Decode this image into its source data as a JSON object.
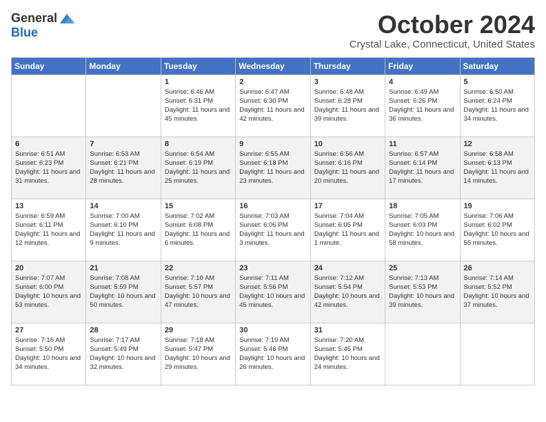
{
  "header": {
    "logo_general": "General",
    "logo_blue": "Blue",
    "month_title": "October 2024",
    "location": "Crystal Lake, Connecticut, United States"
  },
  "weekdays": [
    "Sunday",
    "Monday",
    "Tuesday",
    "Wednesday",
    "Thursday",
    "Friday",
    "Saturday"
  ],
  "weeks": [
    [
      {
        "day": "",
        "info": ""
      },
      {
        "day": "",
        "info": ""
      },
      {
        "day": "1",
        "info": "Sunrise: 6:46 AM\nSunset: 6:31 PM\nDaylight: 11 hours and 45 minutes."
      },
      {
        "day": "2",
        "info": "Sunrise: 6:47 AM\nSunset: 6:30 PM\nDaylight: 11 hours and 42 minutes."
      },
      {
        "day": "3",
        "info": "Sunrise: 6:48 AM\nSunset: 6:28 PM\nDaylight: 11 hours and 39 minutes."
      },
      {
        "day": "4",
        "info": "Sunrise: 6:49 AM\nSunset: 6:26 PM\nDaylight: 11 hours and 36 minutes."
      },
      {
        "day": "5",
        "info": "Sunrise: 6:50 AM\nSunset: 6:24 PM\nDaylight: 11 hours and 34 minutes."
      }
    ],
    [
      {
        "day": "6",
        "info": "Sunrise: 6:51 AM\nSunset: 6:23 PM\nDaylight: 11 hours and 31 minutes."
      },
      {
        "day": "7",
        "info": "Sunrise: 6:53 AM\nSunset: 6:21 PM\nDaylight: 11 hours and 28 minutes."
      },
      {
        "day": "8",
        "info": "Sunrise: 6:54 AM\nSunset: 6:19 PM\nDaylight: 11 hours and 25 minutes."
      },
      {
        "day": "9",
        "info": "Sunrise: 6:55 AM\nSunset: 6:18 PM\nDaylight: 11 hours and 23 minutes."
      },
      {
        "day": "10",
        "info": "Sunrise: 6:56 AM\nSunset: 6:16 PM\nDaylight: 11 hours and 20 minutes."
      },
      {
        "day": "11",
        "info": "Sunrise: 6:57 AM\nSunset: 6:14 PM\nDaylight: 11 hours and 17 minutes."
      },
      {
        "day": "12",
        "info": "Sunrise: 6:58 AM\nSunset: 6:13 PM\nDaylight: 11 hours and 14 minutes."
      }
    ],
    [
      {
        "day": "13",
        "info": "Sunrise: 6:59 AM\nSunset: 6:11 PM\nDaylight: 11 hours and 12 minutes."
      },
      {
        "day": "14",
        "info": "Sunrise: 7:00 AM\nSunset: 6:10 PM\nDaylight: 11 hours and 9 minutes."
      },
      {
        "day": "15",
        "info": "Sunrise: 7:02 AM\nSunset: 6:08 PM\nDaylight: 11 hours and 6 minutes."
      },
      {
        "day": "16",
        "info": "Sunrise: 7:03 AM\nSunset: 6:06 PM\nDaylight: 11 hours and 3 minutes."
      },
      {
        "day": "17",
        "info": "Sunrise: 7:04 AM\nSunset: 6:05 PM\nDaylight: 11 hours and 1 minute."
      },
      {
        "day": "18",
        "info": "Sunrise: 7:05 AM\nSunset: 6:03 PM\nDaylight: 10 hours and 58 minutes."
      },
      {
        "day": "19",
        "info": "Sunrise: 7:06 AM\nSunset: 6:02 PM\nDaylight: 10 hours and 55 minutes."
      }
    ],
    [
      {
        "day": "20",
        "info": "Sunrise: 7:07 AM\nSunset: 6:00 PM\nDaylight: 10 hours and 53 minutes."
      },
      {
        "day": "21",
        "info": "Sunrise: 7:08 AM\nSunset: 5:59 PM\nDaylight: 10 hours and 50 minutes."
      },
      {
        "day": "22",
        "info": "Sunrise: 7:10 AM\nSunset: 5:57 PM\nDaylight: 10 hours and 47 minutes."
      },
      {
        "day": "23",
        "info": "Sunrise: 7:11 AM\nSunset: 5:56 PM\nDaylight: 10 hours and 45 minutes."
      },
      {
        "day": "24",
        "info": "Sunrise: 7:12 AM\nSunset: 5:54 PM\nDaylight: 10 hours and 42 minutes."
      },
      {
        "day": "25",
        "info": "Sunrise: 7:13 AM\nSunset: 5:53 PM\nDaylight: 10 hours and 39 minutes."
      },
      {
        "day": "26",
        "info": "Sunrise: 7:14 AM\nSunset: 5:52 PM\nDaylight: 10 hours and 37 minutes."
      }
    ],
    [
      {
        "day": "27",
        "info": "Sunrise: 7:16 AM\nSunset: 5:50 PM\nDaylight: 10 hours and 34 minutes."
      },
      {
        "day": "28",
        "info": "Sunrise: 7:17 AM\nSunset: 5:49 PM\nDaylight: 10 hours and 32 minutes."
      },
      {
        "day": "29",
        "info": "Sunrise: 7:18 AM\nSunset: 5:47 PM\nDaylight: 10 hours and 29 minutes."
      },
      {
        "day": "30",
        "info": "Sunrise: 7:19 AM\nSunset: 5:46 PM\nDaylight: 10 hours and 26 minutes."
      },
      {
        "day": "31",
        "info": "Sunrise: 7:20 AM\nSunset: 5:45 PM\nDaylight: 10 hours and 24 minutes."
      },
      {
        "day": "",
        "info": ""
      },
      {
        "day": "",
        "info": ""
      }
    ]
  ]
}
